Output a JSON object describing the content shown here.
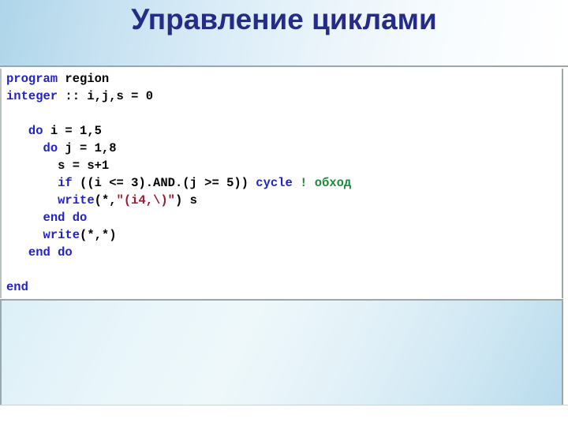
{
  "slide": {
    "title": "Управление циклами",
    "title_color": "#252c87",
    "banner_color": "#aed5ea"
  },
  "code_block": {
    "language": "Fortran",
    "keyword_color": "#2222cc",
    "string_color": "#9c1b30",
    "comment_color": "#1f8a3c",
    "plain_color": "#000000",
    "lines": [
      {
        "id": 1,
        "text": "program region",
        "tokens": [
          {
            "t": "program",
            "c": "kw"
          },
          {
            "t": " region",
            "c": "plain"
          }
        ]
      },
      {
        "id": 2,
        "text": "integer :: i,j,s = 0",
        "tokens": [
          {
            "t": "integer",
            "c": "kw"
          },
          {
            "t": " :: i,j,s = 0",
            "c": "plain"
          }
        ]
      },
      {
        "id": 3,
        "text": "",
        "tokens": []
      },
      {
        "id": 4,
        "text": "   do i = 1,5",
        "tokens": [
          {
            "t": "   ",
            "c": "plain"
          },
          {
            "t": "do",
            "c": "kw"
          },
          {
            "t": " i = 1,5",
            "c": "plain"
          }
        ]
      },
      {
        "id": 5,
        "text": "     do j = 1,8",
        "tokens": [
          {
            "t": "     ",
            "c": "plain"
          },
          {
            "t": "do",
            "c": "kw"
          },
          {
            "t": " j = 1,8",
            "c": "plain"
          }
        ]
      },
      {
        "id": 6,
        "text": "       s = s+1",
        "tokens": [
          {
            "t": "       s = s+1",
            "c": "plain"
          }
        ]
      },
      {
        "id": 7,
        "text": "       if ((i <= 3).AND.(j >= 5)) cycle ! обход",
        "tokens": [
          {
            "t": "       ",
            "c": "plain"
          },
          {
            "t": "if",
            "c": "kw"
          },
          {
            "t": " ((i <= 3).AND.(j >= 5)) ",
            "c": "plain"
          },
          {
            "t": "cycle",
            "c": "kw"
          },
          {
            "t": " ",
            "c": "plain"
          },
          {
            "t": "! обход",
            "c": "cmt"
          }
        ]
      },
      {
        "id": 8,
        "text": "       write(*,\"(i4,\\)\") s",
        "tokens": [
          {
            "t": "       ",
            "c": "plain"
          },
          {
            "t": "write",
            "c": "kw"
          },
          {
            "t": "(*,",
            "c": "plain"
          },
          {
            "t": "\"(i4,\\)\"",
            "c": "str"
          },
          {
            "t": ") s",
            "c": "plain"
          }
        ]
      },
      {
        "id": 9,
        "text": "     end do",
        "tokens": [
          {
            "t": "     ",
            "c": "plain"
          },
          {
            "t": "end do",
            "c": "kw"
          }
        ]
      },
      {
        "id": 10,
        "text": "     write(*,*)",
        "tokens": [
          {
            "t": "     ",
            "c": "plain"
          },
          {
            "t": "write",
            "c": "kw"
          },
          {
            "t": "(*,*)",
            "c": "plain"
          }
        ]
      },
      {
        "id": 11,
        "text": "   end do",
        "tokens": [
          {
            "t": "   ",
            "c": "plain"
          },
          {
            "t": "end do",
            "c": "kw"
          }
        ]
      },
      {
        "id": 12,
        "text": "",
        "tokens": []
      },
      {
        "id": 13,
        "text": "end",
        "tokens": [
          {
            "t": "end",
            "c": "kw"
          }
        ]
      }
    ]
  },
  "bottom_panel": {
    "content": ""
  }
}
